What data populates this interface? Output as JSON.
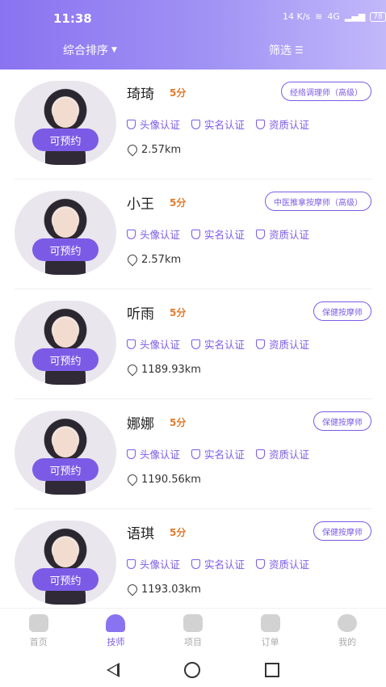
{
  "status": {
    "time": "11:38",
    "net": "14 K/s",
    "signal": "4G",
    "battery": "78"
  },
  "toolbar": {
    "sort_label": "综合排序",
    "filter_label": "筛选"
  },
  "technicians": [
    {
      "name": "琦琦",
      "score": "5分",
      "tag": "经络调理师（高级）",
      "cert1": "头像认证",
      "cert2": "实名认证",
      "cert3": "资质认证",
      "distance": "2.57km",
      "book": "可预约"
    },
    {
      "name": "小王",
      "score": "5分",
      "tag": "中医推拿按摩师（高级）",
      "cert1": "头像认证",
      "cert2": "实名认证",
      "cert3": "资质认证",
      "distance": "2.57km",
      "book": "可预约"
    },
    {
      "name": "听雨",
      "score": "5分",
      "tag": "保健按摩师",
      "cert1": "头像认证",
      "cert2": "实名认证",
      "cert3": "资质认证",
      "distance": "1189.93km",
      "book": "可预约"
    },
    {
      "name": "娜娜",
      "score": "5分",
      "tag": "保健按摩师",
      "cert1": "头像认证",
      "cert2": "实名认证",
      "cert3": "资质认证",
      "distance": "1190.56km",
      "book": "可预约"
    },
    {
      "name": "语琪",
      "score": "5分",
      "tag": "保健按摩师",
      "cert1": "头像认证",
      "cert2": "实名认证",
      "cert3": "资质认证",
      "distance": "1193.03km",
      "book": "可预约"
    }
  ],
  "tabs": [
    {
      "label": "首页",
      "icon": "home-icon"
    },
    {
      "label": "技师",
      "icon": "technician-icon"
    },
    {
      "label": "项目",
      "icon": "project-icon"
    },
    {
      "label": "订单",
      "icon": "order-icon"
    },
    {
      "label": "我的",
      "icon": "profile-icon"
    }
  ],
  "colors": {
    "accent": "#7b5be6",
    "score": "#e07a2a"
  }
}
